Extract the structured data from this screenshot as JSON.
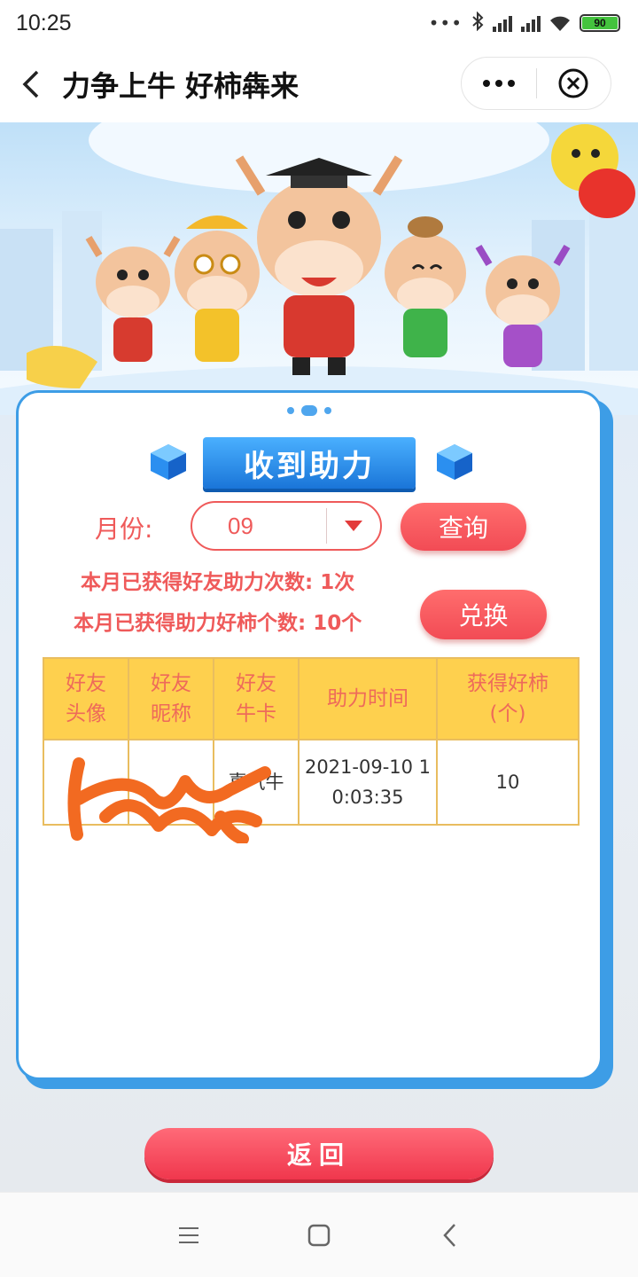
{
  "status_bar": {
    "time": "10:25",
    "battery": "90"
  },
  "nav": {
    "title": "力争上牛 好柿犇来"
  },
  "card": {
    "title": "收到助力",
    "month_label": "月份:",
    "month_value": "09",
    "query_label": "查询",
    "info_count": "本月已获得好友助力次数: 1次",
    "info_persimmons": "本月已获得助力好柿个数: 10个",
    "exchange_label": "兑换",
    "table": {
      "headers": [
        {
          "line1": "好友",
          "line2": "头像"
        },
        {
          "line1": "好友",
          "line2": "昵称"
        },
        {
          "line1": "好友",
          "line2": "牛卡"
        },
        {
          "line1": "助力时间",
          "line2": ""
        },
        {
          "line1": "获得好柿",
          "line2": "(个)"
        }
      ],
      "rows": [
        {
          "avatar": "",
          "nickname": "",
          "card": "喜气牛",
          "time_line1": "2021-09-10 1",
          "time_line2": "0:03:35",
          "count": "10"
        }
      ]
    }
  },
  "return_label": "返回",
  "colors": {
    "primary_red": "#ef5a5a",
    "accent_blue": "#3d9de6",
    "header_yellow": "#fed04e"
  }
}
